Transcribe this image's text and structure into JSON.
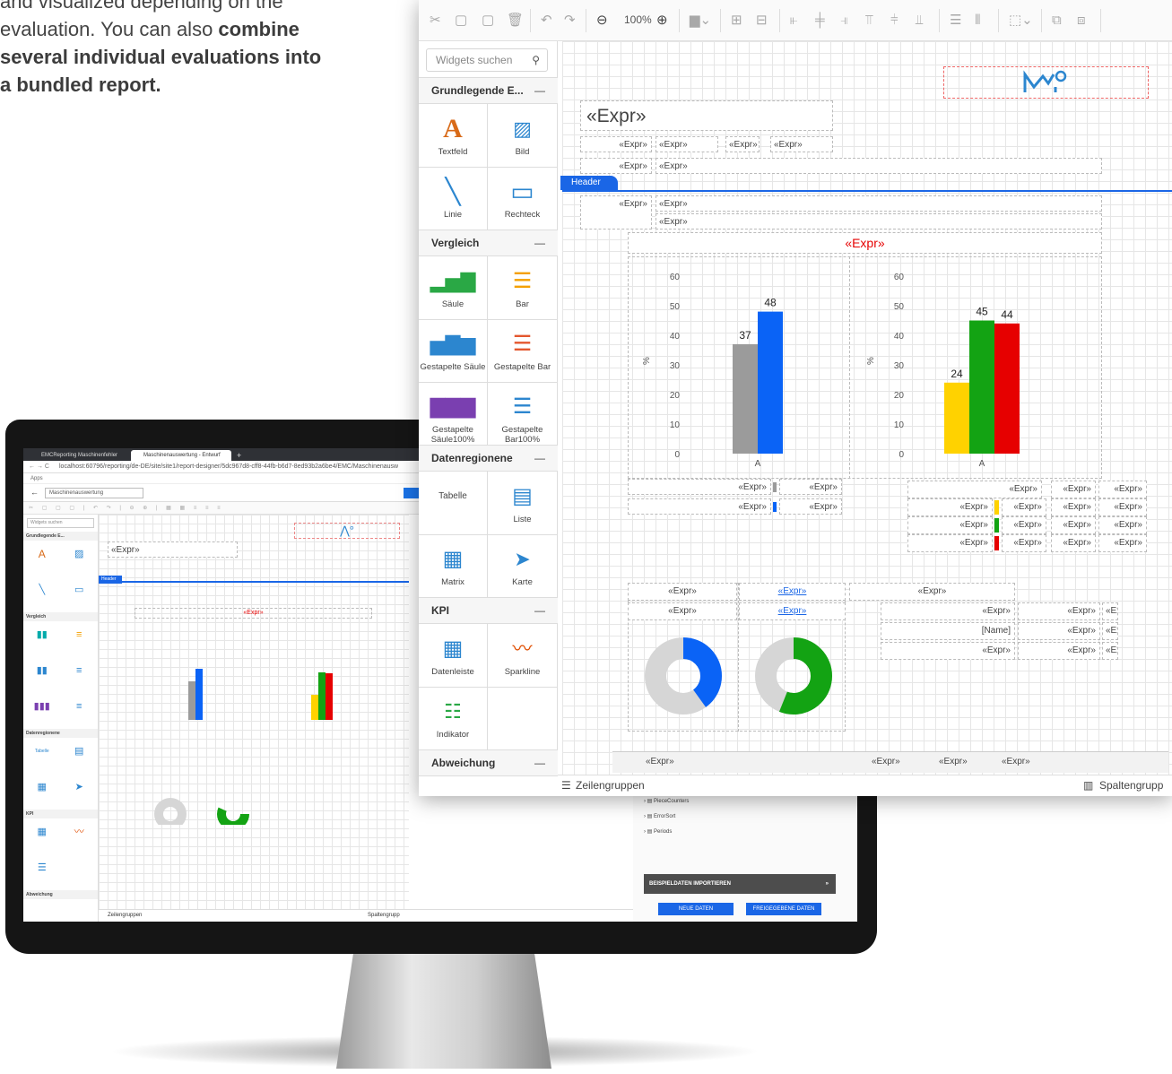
{
  "intro": {
    "line1": "and visualized depending on the",
    "line2_a": "evaluation. You can also ",
    "line2_b": "combine",
    "line3": "several individual evaluations into",
    "line4": "a bundled report."
  },
  "toolbar": {
    "zoom": "100%"
  },
  "sidebar": {
    "search_placeholder": "Widgets suchen",
    "categories": [
      {
        "label": "Grundlegende E...",
        "collapse": "—"
      },
      {
        "label": "Vergleich",
        "collapse": "—"
      },
      {
        "label": "Datenregionene",
        "collapse": "—"
      },
      {
        "label": "KPI",
        "collapse": "—"
      },
      {
        "label": "Abweichung",
        "collapse": "—"
      }
    ],
    "widgets": {
      "textfeld": "Textfeld",
      "bild": "Bild",
      "linie": "Linie",
      "rechteck": "Rechteck",
      "saule": "Säule",
      "bar": "Bar",
      "gest_saule": "Gestapelte Säule",
      "gest_bar": "Gestapelte Bar",
      "gest_saule100": "Gestapelte Säule100%",
      "gest_bar100": "Gestapelte Bar100%",
      "tabelle": "Tabelle",
      "liste": "Liste",
      "matrix": "Matrix",
      "karte": "Karte",
      "datenleiste": "Datenleiste",
      "sparkline": "Sparkline",
      "indikator": "Indikator"
    }
  },
  "canvas": {
    "expr_title": "«Expr»",
    "expr": "«Expr»",
    "header_band": "Header",
    "name_field": "[Name]",
    "expr_truncated": "«Ex"
  },
  "footer": {
    "row_groups": "Zeilengruppen",
    "col_groups": "Spaltengrupp"
  },
  "monitor": {
    "tab1": "EMCReporting Maschinenfehler",
    "tab2": "Maschinenauswertung - Entwurf",
    "url": "localhost:60796/reporting/de-DE/site/site1/report-designer/5dc967d8-cff8-44fb-b6d7-8ed93b2a6be4/EMC/Maschinenausw",
    "apps": "Apps",
    "report_name": "Maschinenauswertung",
    "side_items": [
      "PieceCounters",
      "ErrorSort",
      "Periods"
    ],
    "import_label": "BEISPIELDATEN IMPORTIEREN",
    "new_data": "NEUE DATEN",
    "shared_data": "FREIGEGEBENE DATEN"
  },
  "colors": {
    "blue": "#0a63f6",
    "gray": "#9b9b9b",
    "yellow": "#ffd200",
    "green": "#13a313",
    "red": "#e60000",
    "header": "#1a66e6"
  },
  "chart_data": [
    {
      "type": "bar",
      "ylabel": "%",
      "ylim": [
        0,
        60
      ],
      "yticks": [
        0,
        10,
        20,
        30,
        40,
        50,
        60
      ],
      "categories": [
        "A"
      ],
      "series": [
        {
          "values": [
            37
          ]
        },
        {
          "values": [
            48
          ]
        }
      ]
    },
    {
      "type": "bar",
      "ylabel": "%",
      "ylim": [
        0,
        60
      ],
      "yticks": [
        0,
        10,
        20,
        30,
        40,
        50,
        60
      ],
      "categories": [
        "A"
      ],
      "series": [
        {
          "values": [
            24
          ]
        },
        {
          "values": [
            45
          ]
        },
        {
          "values": [
            44
          ]
        }
      ]
    },
    {
      "type": "pie",
      "values": [
        40,
        60
      ]
    },
    {
      "type": "pie",
      "values": [
        56,
        44
      ]
    }
  ]
}
